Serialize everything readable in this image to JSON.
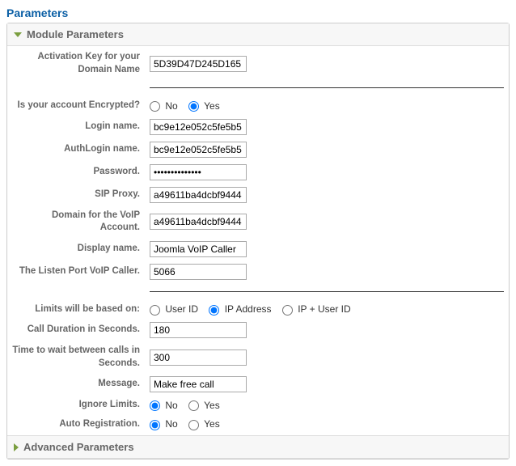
{
  "panel": {
    "title": "Parameters"
  },
  "sections": {
    "module": {
      "title": "Module Parameters",
      "expanded": true
    },
    "advanced": {
      "title": "Advanced Parameters",
      "expanded": false
    }
  },
  "fields": {
    "activation_key": {
      "label": "Activation Key for your Domain Name",
      "value": "5D39D47D245D165"
    },
    "encrypted": {
      "label": "Is your account Encrypted?",
      "options": {
        "no": "No",
        "yes": "Yes"
      },
      "selected": "yes"
    },
    "login_name": {
      "label": "Login name.",
      "value": "bc9e12e052c5fe5b5"
    },
    "auth_login": {
      "label": "AuthLogin name.",
      "value": "bc9e12e052c5fe5b5"
    },
    "password": {
      "label": "Password.",
      "value": "••••••••••••••"
    },
    "sip_proxy": {
      "label": "SIP Proxy.",
      "value": "a49611ba4dcbf9444"
    },
    "voip_domain": {
      "label": "Domain for the VoIP Account.",
      "value": "a49611ba4dcbf9444"
    },
    "display_name": {
      "label": "Display name.",
      "value": "Joomla VoIP Caller"
    },
    "listen_port": {
      "label": "The Listen Port VoIP Caller.",
      "value": "5066"
    },
    "limits_based": {
      "label": "Limits will be based on:",
      "options": {
        "user": "User ID",
        "ip": "IP Address",
        "ipuser": "IP + User ID"
      },
      "selected": "ip"
    },
    "call_duration": {
      "label": "Call Duration in Seconds.",
      "value": "180"
    },
    "wait_time": {
      "label": "Time to wait between calls in Seconds.",
      "value": "300"
    },
    "message": {
      "label": "Message.",
      "value": "Make free call"
    },
    "ignore_limits": {
      "label": "Ignore Limits.",
      "options": {
        "no": "No",
        "yes": "Yes"
      },
      "selected": "no"
    },
    "auto_reg": {
      "label": "Auto Registration.",
      "options": {
        "no": "No",
        "yes": "Yes"
      },
      "selected": "no"
    }
  }
}
